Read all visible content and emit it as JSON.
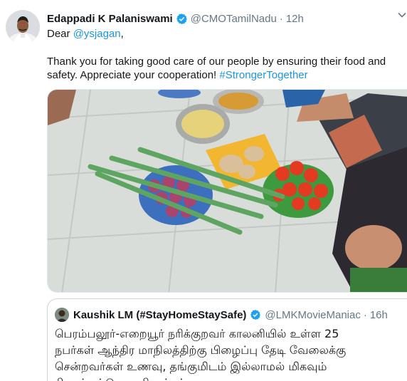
{
  "tweet": {
    "author_name": "Edappadi K Palaniswami",
    "handle": "@CMOTamilNadu",
    "separator": "·",
    "time": "12h",
    "line1_prefix": "Dear ",
    "mention": "@ysjagan",
    "line1_suffix": ",",
    "line2": "Thank you for taking good care of our people by ensuring their food and",
    "line3_text": "safety. Appreciate your cooperation! ",
    "hashtag": "#StrongerTogether",
    "verified_icon": "verified-badge-icon",
    "menu_icon": "chevron-down-icon"
  },
  "quoted_tweet": {
    "author_name": "Kaushik LM (#StayHomeStaySafe)",
    "handle": "@LMKMovieManiac",
    "separator": "·",
    "time": "16h",
    "lines": [
      "பெரம்பலூர்-எறையூர் நரிக்குறவர் காலனியில் உள்ள 25",
      "நபர்கள் ஆந்திர மாநிலத்திற்கு பிழைப்பு தேடி வேலைக்கு",
      "சென்றவர்கள் உணவு, தங்குமிடம் இல்லாமல் மிகவும்",
      "சிரமப்பட்டு வருகிறார்கள்."
    ]
  },
  "colors": {
    "link": "#1b95e0",
    "verified": "#1da1f2",
    "secondary_text": "#657786",
    "border": "#ccd6dd"
  }
}
